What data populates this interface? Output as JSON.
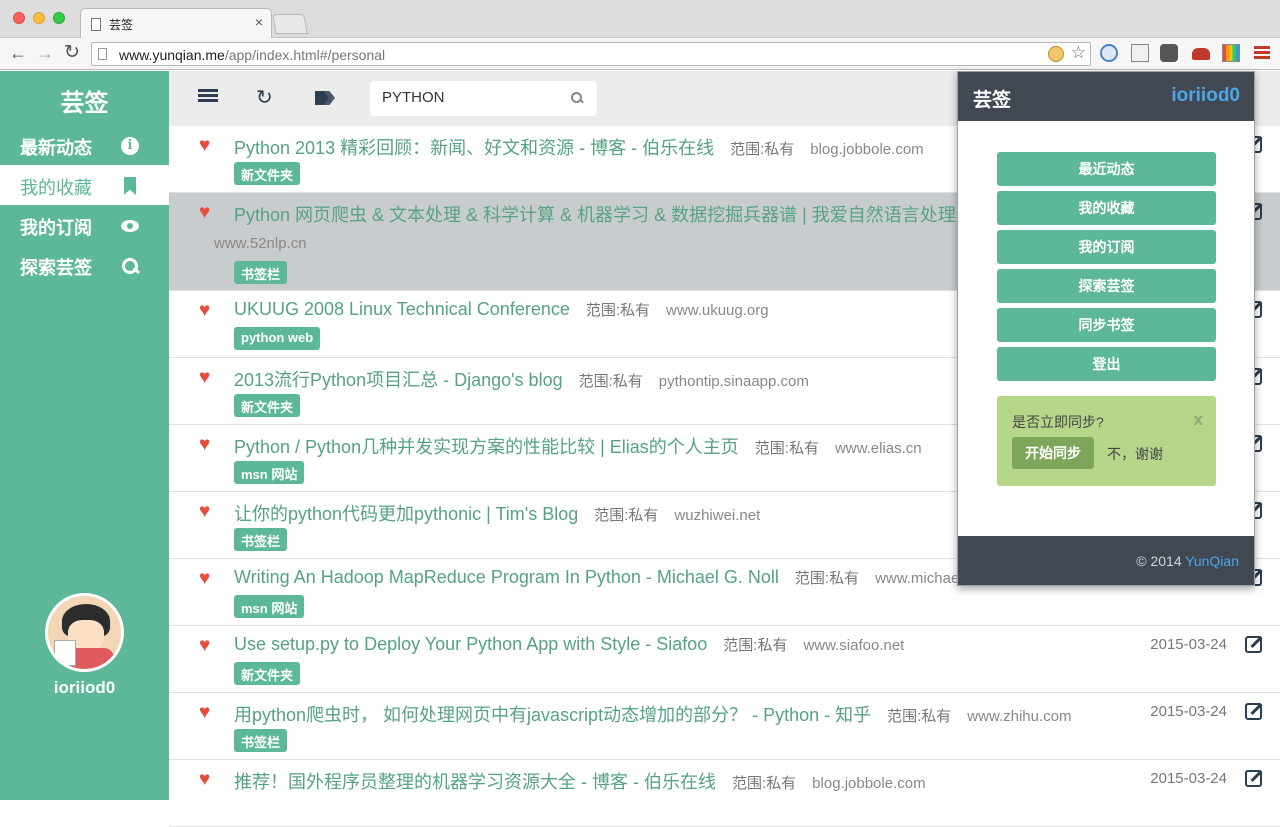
{
  "browser": {
    "tab_title": "芸签",
    "tab_close": "×",
    "url_host": "www.yunqian.me",
    "url_path": "/app/index.html#/personal"
  },
  "sidebar": {
    "brand": "芸签",
    "items": [
      {
        "label": "最新动态",
        "icon": "info-icon"
      },
      {
        "label": "我的收藏",
        "icon": "bookmark-icon"
      },
      {
        "label": "我的订阅",
        "icon": "eye-icon"
      },
      {
        "label": "探索芸签",
        "icon": "search-icon"
      }
    ],
    "active_index": 1,
    "username": "ioriiod0"
  },
  "topbar": {
    "search_value": "PYTHON"
  },
  "rows": [
    {
      "title": "Python 2013 精彩回顾：新闻、好文和资源 - 博客 - 伯乐在线",
      "scope": "范围:私有",
      "domain": "blog.jobbole.com",
      "tag": "新文件夹",
      "date": ""
    },
    {
      "title": "Python 网页爬虫 & 文本处理 & 科学计算 & 机器学习 & 数据挖掘兵器谱 | 我爱自然语言处理",
      "scope": "范围:私有",
      "domain": "www.52nlp.cn",
      "tag": "书签栏",
      "date": ""
    },
    {
      "title": "UKUUG 2008 Linux Technical Conference",
      "scope": "范围:私有",
      "domain": "www.ukuug.org",
      "tag": "python web",
      "date": ""
    },
    {
      "title": "2013流行Python项目汇总 - Django's blog",
      "scope": "范围:私有",
      "domain": "pythontip.sinaapp.com",
      "tag": "新文件夹",
      "date": ""
    },
    {
      "title": "Python / Python几种并发实现方案的性能比较 | Elias的个人主页",
      "scope": "范围:私有",
      "domain": "www.elias.cn",
      "tag": "msn 网站",
      "date": ""
    },
    {
      "title": "让你的python代码更加pythonic | Tim's Blog",
      "scope": "范围:私有",
      "domain": "wuzhiwei.net",
      "tag": "书签栏",
      "date": ""
    },
    {
      "title": "Writing An Hadoop MapReduce Program In Python - Michael G. Noll",
      "scope": "范围:私有",
      "domain": "www.michael",
      "tag": "msn 网站",
      "date": ""
    },
    {
      "title": "Use setup.py to Deploy Your Python App with Style - Siafoo",
      "scope": "范围:私有",
      "domain": "www.siafoo.net",
      "tag": "新文件夹",
      "date": "2015-03-24"
    },
    {
      "title": "用python爬虫时， 如何处理网页中有javascript动态增加的部分？ - Python - 知乎",
      "scope": "范围:私有",
      "domain": "www.zhihu.com",
      "tag": "书签栏",
      "date": "2015-03-24"
    },
    {
      "title": "推荐！国外程序员整理的机器学习资源大全 - 博客 - 伯乐在线",
      "scope": "范围:私有",
      "domain": "blog.jobbole.com",
      "tag": "",
      "date": "2015-03-24"
    }
  ],
  "popup": {
    "brand": "芸签",
    "user": "ioriiod0",
    "buttons": [
      "最近动态",
      "我的收藏",
      "我的订阅",
      "探索芸签",
      "同步书签",
      "登出"
    ],
    "sync_question": "是否立即同步?",
    "sync_close": "x",
    "sync_start": "开始同步",
    "sync_decline": "不，谢谢",
    "copyright_prefix": "© 2014 ",
    "copyright_link": "YunQian"
  },
  "colors": {
    "brand_green": "#5cb898",
    "heart_red": "#e74c3c",
    "dark_header": "#414852",
    "link_blue": "#4aa8e8"
  }
}
